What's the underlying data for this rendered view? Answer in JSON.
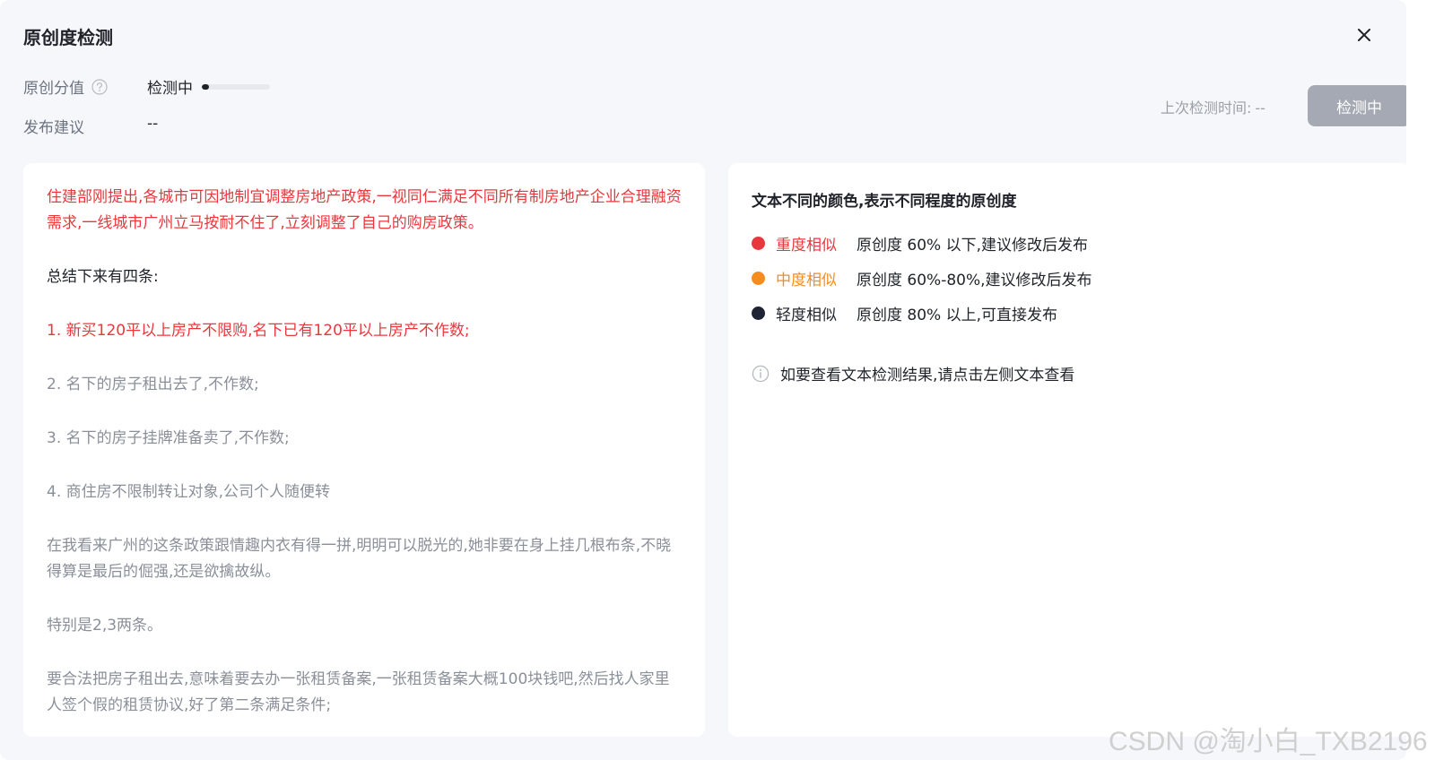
{
  "dialog": {
    "title": "原创度检测"
  },
  "score": {
    "label": "原创分值",
    "status": "检测中",
    "progress_fraction": 0.1
  },
  "advice": {
    "label": "发布建议",
    "value": "--"
  },
  "last_check": {
    "label": "上次检测时间:",
    "value": "--"
  },
  "detect_button": {
    "label": "检测中"
  },
  "article": {
    "paragraphs": [
      {
        "text": "住建部刚提出,各城市可因地制宜调整房地产政策,一视同仁满足不同所有制房地产企业合理融资需求,一线城市广州立马按耐不住了,立刻调整了自己的购房政策。",
        "level": "heavy"
      },
      {
        "text": "总结下来有四条:",
        "level": "dark"
      },
      {
        "text": "1. 新买120平以上房产不限购,名下已有120平以上房产不作数;",
        "level": "heavy"
      },
      {
        "text": "2. 名下的房子租出去了,不作数;",
        "level": "light"
      },
      {
        "text": "3. 名下的房子挂牌准备卖了,不作数;",
        "level": "light"
      },
      {
        "text": "4. 商住房不限制转让对象,公司个人随便转",
        "level": "light"
      },
      {
        "text": "在我看来广州的这条政策跟情趣内衣有得一拼,明明可以脱光的,她非要在身上挂几根布条,不晓得算是最后的倔强,还是欲擒故纵。",
        "level": "light"
      },
      {
        "text": "特别是2,3两条。",
        "level": "light"
      },
      {
        "text": "要合法把房子租出去,意味着要去办一张租赁备案,一张租赁备案大概100块钱吧,然后找人家里人签个假的租赁协议,好了第二条满足条件;",
        "level": "light"
      }
    ]
  },
  "legend": {
    "title": "文本不同的颜色,表示不同程度的原创度",
    "items": [
      {
        "name": "重度相似",
        "desc": "原创度 60% 以下,建议修改后发布",
        "color": "#e8383d"
      },
      {
        "name": "中度相似",
        "desc": "原创度 60%-80%,建议修改后发布",
        "color": "#f58d1e"
      },
      {
        "name": "轻度相似",
        "desc": "原创度 80% 以上,可直接发布",
        "color": "#1f2333"
      }
    ]
  },
  "hint": {
    "text": "如要查看文本检测结果,请点击左侧文本查看",
    "icon": "info-icon"
  },
  "watermark": {
    "text": "CSDN @淘小白_TXB2196"
  }
}
